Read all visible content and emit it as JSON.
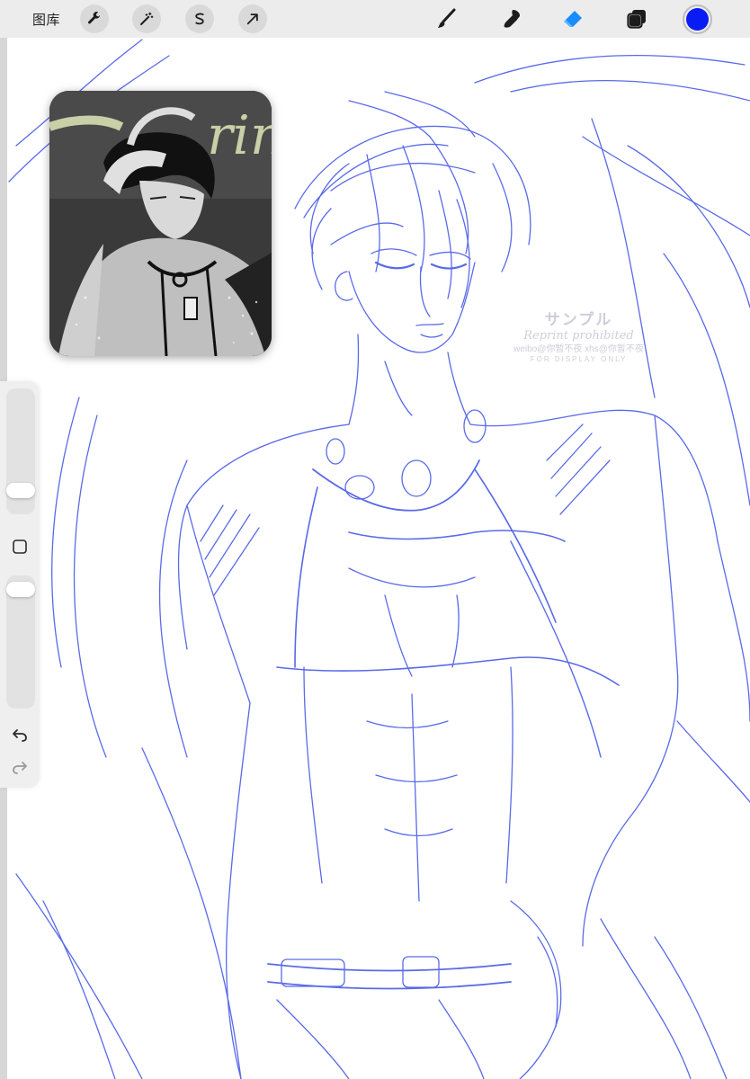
{
  "toolbar": {
    "gallery_label": "图库",
    "left_tools": [
      {
        "name": "actions",
        "icon": "wrench-icon"
      },
      {
        "name": "adjustments",
        "icon": "magic-wand-icon"
      },
      {
        "name": "selection",
        "icon": "selection-s-icon"
      },
      {
        "name": "transform",
        "icon": "arrow-icon"
      }
    ],
    "right_tools": [
      {
        "name": "brush",
        "icon": "brush-icon",
        "active": false
      },
      {
        "name": "smudge",
        "icon": "smudge-icon",
        "active": false
      },
      {
        "name": "eraser",
        "icon": "eraser-icon",
        "active": true
      },
      {
        "name": "layers",
        "icon": "layers-icon",
        "active": false
      }
    ],
    "current_color": "#0a1cf5",
    "active_tool_color": "#1a8cff"
  },
  "sidebar": {
    "brush_size_level": 0.15,
    "opacity_level": 0.95,
    "modifier_icon": "square-icon",
    "undo_icon": "undo-icon",
    "redo_icon": "redo-icon"
  },
  "canvas": {
    "stroke_color": "#5a6ae8",
    "watermark": {
      "line1": "サンプル",
      "line2": "Reprint prohibited",
      "line3": "weibo@你暂不夜 xhs@你暂不夜",
      "line4": "FOR DISPLAY ONLY"
    }
  },
  "reference_window": {
    "title_fragment": "rin"
  }
}
